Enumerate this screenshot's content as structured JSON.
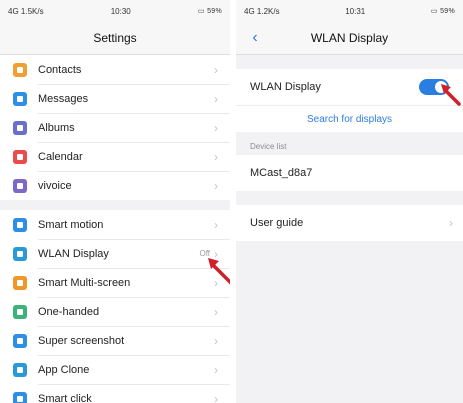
{
  "left": {
    "status": {
      "left": "4G 1.5K/s",
      "time": "10:30",
      "right": "59%"
    },
    "title": "Settings",
    "group1": [
      {
        "label": "Contacts",
        "icon": "contacts-icon",
        "color": "#f0a030"
      },
      {
        "label": "Messages",
        "icon": "messages-icon",
        "color": "#2f8fe6"
      },
      {
        "label": "Albums",
        "icon": "albums-icon",
        "color": "#6a6fc7"
      },
      {
        "label": "Calendar",
        "icon": "calendar-icon",
        "color": "#ea4b4b"
      },
      {
        "label": "vivoice",
        "icon": "vivoice-icon",
        "color": "#7b68c9"
      }
    ],
    "group2": [
      {
        "label": "Smart motion",
        "icon": "smart-motion-icon",
        "color": "#2f8fe6"
      },
      {
        "label": "WLAN Display",
        "icon": "wlan-display-icon",
        "color": "#2a9ad6",
        "value": "Off"
      },
      {
        "label": "Smart Multi-screen",
        "icon": "smart-multiscreen-icon",
        "color": "#f0962a"
      },
      {
        "label": "One-handed",
        "icon": "one-handed-icon",
        "color": "#3cb37a"
      },
      {
        "label": "Super screenshot",
        "icon": "super-screenshot-icon",
        "color": "#2f8fe6"
      },
      {
        "label": "App Clone",
        "icon": "app-clone-icon",
        "color": "#2a9ad6"
      },
      {
        "label": "Smart click",
        "icon": "smart-click-icon",
        "color": "#2f8fe6"
      }
    ]
  },
  "right": {
    "status": {
      "left": "4G 1.2K/s",
      "time": "10:31",
      "right": "59%"
    },
    "title": "WLAN Display",
    "toggle_label": "WLAN Display",
    "toggle_on": true,
    "search_label": "Search for displays",
    "device_list_label": "Device list",
    "device_name": "MCast_d8a7",
    "user_guide_label": "User guide"
  },
  "colors": {
    "accent": "#2a7de1",
    "arrow": "#d0202a",
    "background": "#f2f2f4"
  }
}
